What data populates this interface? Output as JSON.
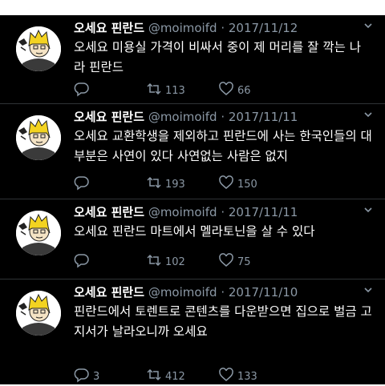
{
  "tweets": [
    {
      "name": "오세요 핀란드",
      "handle": "@moimoifd",
      "sep": "·",
      "date": "2017/11/12",
      "text": "오세요 미용실 가격이 비싸서 중이 제 머리를 잘 깍는 나라 핀란드",
      "replies": "",
      "retweets": "113",
      "likes": "66"
    },
    {
      "name": "오세요 핀란드",
      "handle": "@moimoifd",
      "sep": "·",
      "date": "2017/11/11",
      "text": "오세요 교환학생을 제외하고 핀란드에 사는 한국인들의 대부분은 사연이 있다 사연없는 사람은 없지",
      "replies": "",
      "retweets": "193",
      "likes": "150"
    },
    {
      "name": "오세요 핀란드",
      "handle": "@moimoifd",
      "sep": "·",
      "date": "2017/11/11",
      "text": "오세요 핀란드 마트에서 멜라토닌을 살 수 있다",
      "replies": "",
      "retweets": "102",
      "likes": "75"
    },
    {
      "name": "오세요 핀란드",
      "handle": "@moimoifd",
      "sep": "·",
      "date": "2017/11/10",
      "text": "핀란드에서 토렌트로 콘텐츠를 다운받으면 집으로 벌금 고지서가 날라오니까 오세요",
      "replies": "3",
      "retweets": "412",
      "likes": "133"
    }
  ],
  "icons": {
    "reply": "reply-icon",
    "retweet": "retweet-icon",
    "like": "heart-icon",
    "caret": "chevron-down-icon",
    "avatar": "avatar"
  },
  "colors": {
    "background": "#000000",
    "text": "#ffffff",
    "muted": "#8b98a5",
    "divider": "#2f3336"
  }
}
